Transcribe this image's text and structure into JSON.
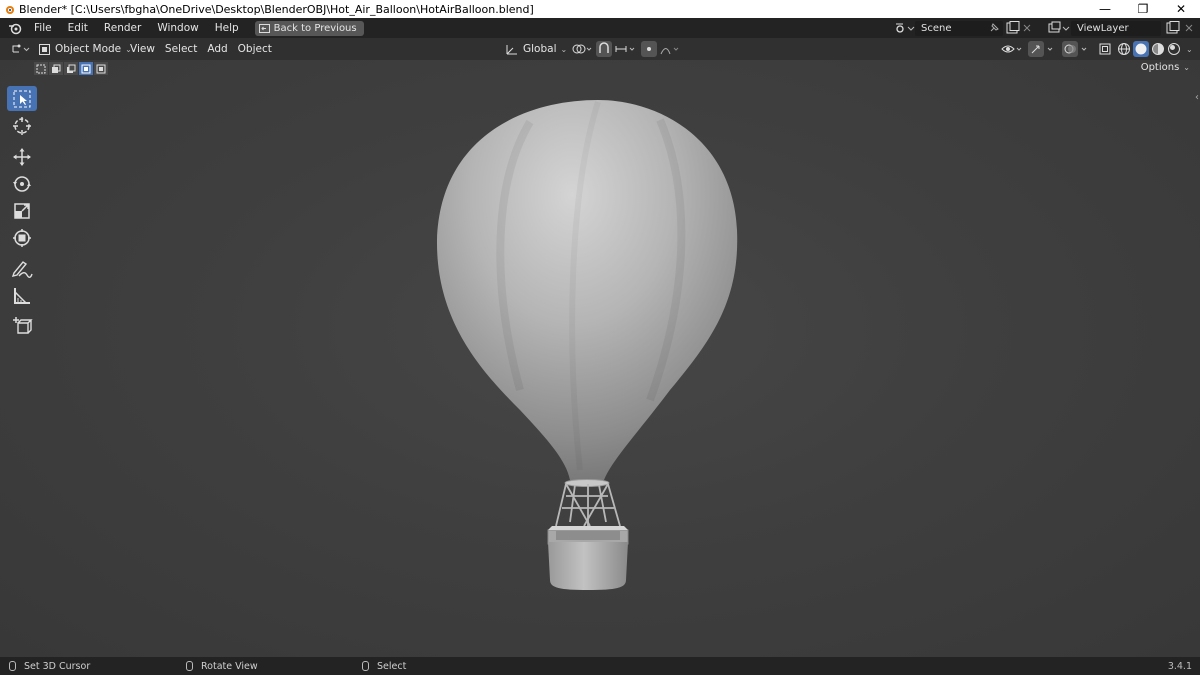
{
  "window": {
    "title": "Blender* [C:\\Users\\fbgha\\OneDrive\\Desktop\\BlenderOBJ\\Hot_Air_Balloon\\HotAirBalloon.blend]",
    "minimize": "—",
    "maximize": "❐",
    "close": "✕"
  },
  "menubar": {
    "items": [
      "File",
      "Edit",
      "Render",
      "Window",
      "Help"
    ],
    "back_button": "Back to Previous",
    "scene": "Scene",
    "view_layer": "ViewLayer"
  },
  "viewport_header": {
    "mode": "Object Mode",
    "menus": [
      "View",
      "Select",
      "Add",
      "Object"
    ],
    "orientation": "Global",
    "options_label": "Options"
  },
  "toolbar": {
    "tools": [
      "select-box",
      "cursor",
      "move",
      "rotate",
      "scale",
      "transform",
      "annotate",
      "measure",
      "add-cube"
    ],
    "active_tool": "select-box"
  },
  "statusbar": {
    "left_click": "Set 3D Cursor",
    "middle_click": "Rotate View",
    "right_click": "Select",
    "version": "3.4.1"
  },
  "colors": {
    "accent": "#4772b3",
    "viewport_bg": "#3d3d3d",
    "header_bg": "#303030",
    "bar_bg": "#232323"
  }
}
